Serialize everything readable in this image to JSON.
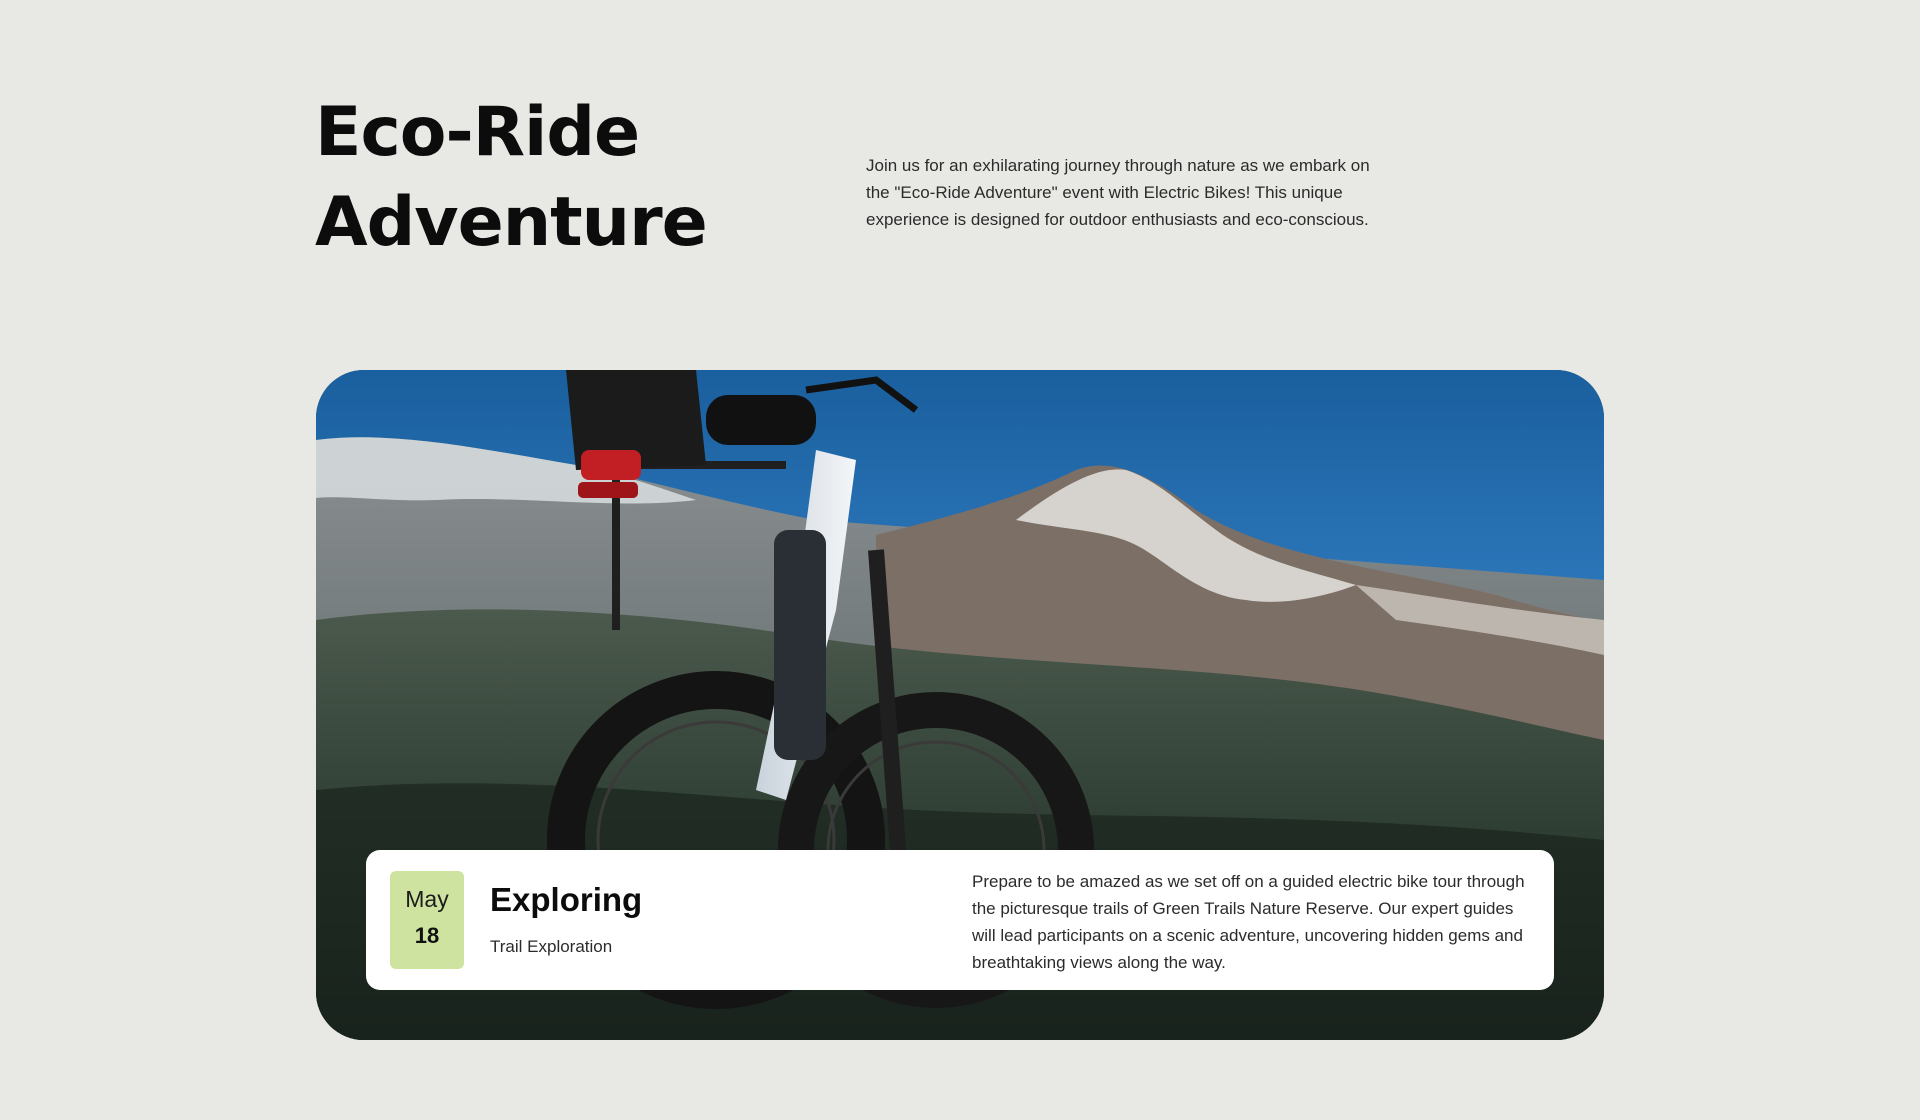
{
  "hero": {
    "title_line1": "Eco-Ride",
    "title_line2": "Adventure",
    "intro": "Join us for an exhilarating journey through nature as we embark on the \"Eco-Ride Adventure\" event with Electric Bikes! This unique experience is designed for outdoor enthusiasts and eco-conscious."
  },
  "event": {
    "date_month": "May",
    "date_day": "18",
    "title": "Exploring",
    "subtitle": "Trail Exploration",
    "description": "Prepare to be amazed as we set off on a guided electric bike tour through the picturesque trails of Green Trails Nature Reserve. Our expert guides will lead participants on a scenic adventure, uncovering hidden gems and breathtaking views along the way."
  },
  "colors": {
    "page_background": "#e8e9e4",
    "date_badge": "#cfe3a0",
    "panel": "#ffffff"
  }
}
